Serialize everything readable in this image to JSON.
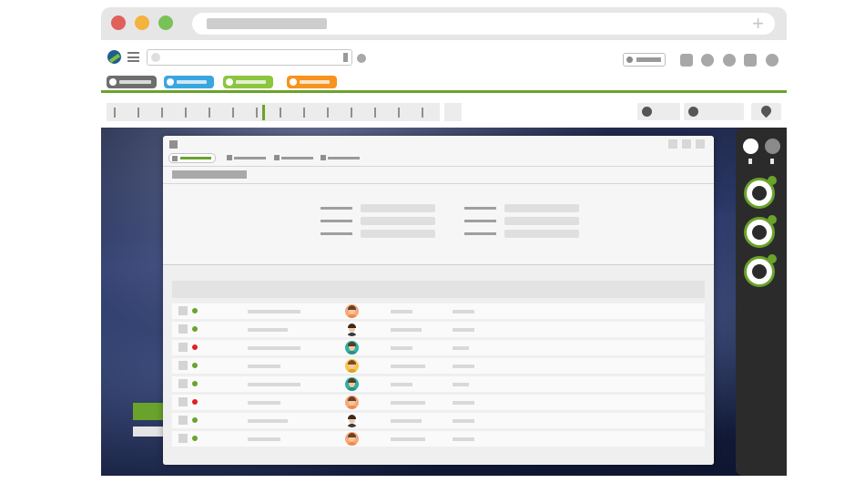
{
  "colors": {
    "accent_green": "#6aa32b",
    "traffic_red": "#e0605c",
    "traffic_yellow": "#f4b23e",
    "traffic_green": "#7bc15a",
    "tag_gray": "#6e6e6e",
    "tag_blue": "#3aa6e0",
    "tag_green": "#8cc63f",
    "tag_orange": "#f7931e",
    "status_online": "#6aa32b",
    "status_offline": "#e02020"
  },
  "browser": {
    "new_tab_symbol": "+"
  },
  "icons": {
    "logo": "app-logo-icon",
    "menu": "hamburger-menu-icon",
    "pin": "map-pin-icon"
  },
  "rows": [
    {
      "status": "online",
      "avatar": "male-orange-shirt"
    },
    {
      "status": "online",
      "avatar": "male-suit"
    },
    {
      "status": "offline",
      "avatar": "female-teal"
    },
    {
      "status": "online",
      "avatar": "female-yellow"
    },
    {
      "status": "online",
      "avatar": "female-teal"
    },
    {
      "status": "offline",
      "avatar": "male-orange-shirt"
    },
    {
      "status": "online",
      "avatar": "male-suit"
    },
    {
      "status": "online",
      "avatar": "male-orange-shirt"
    }
  ]
}
